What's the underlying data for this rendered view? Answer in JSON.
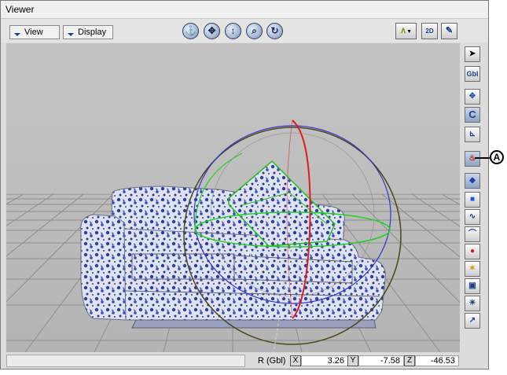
{
  "window": {
    "title": "Viewer"
  },
  "toolbar": {
    "view_menu": "View",
    "display_menu": "Display",
    "nav_icons": [
      "anchor-icon",
      "pan-icon",
      "dolly-icon",
      "zoom-icon",
      "orbit-icon"
    ],
    "right_icons": [
      "curve-icon",
      "zoom-2d-icon",
      "edit-camera-icon"
    ],
    "zoom_2d_label": "2D"
  },
  "side_tools": {
    "global_label": "Gbl",
    "items": [
      "select-arrow-icon",
      "global-icon",
      "translate-icon",
      "rotate-icon",
      "scale-icon",
      "rotate-manipulator-icon",
      "object-select-icon",
      "cube-icon",
      "curve-points-icon",
      "path-icon",
      "light-sphere-icon",
      "star-light-icon",
      "camera-icon",
      "sun-light-icon",
      "hook-icon"
    ]
  },
  "callout": {
    "label": "A"
  },
  "status": {
    "mode_label": "R (Gbl)",
    "x_label": "X",
    "x_value": "3.26",
    "y_label": "Y",
    "y_value": "-7.58",
    "z_label": "Z",
    "z_value": "-46.53"
  },
  "colors": {
    "grid_background": "#a9a9a9",
    "sofa_base": "#dfe3f0",
    "sofa_pattern": "#2e3ea0",
    "ring_red": "#e0181e",
    "ring_blue": "#3535c8",
    "ring_green": "#1ed21e",
    "ring_outer": "#4a4a1c"
  }
}
